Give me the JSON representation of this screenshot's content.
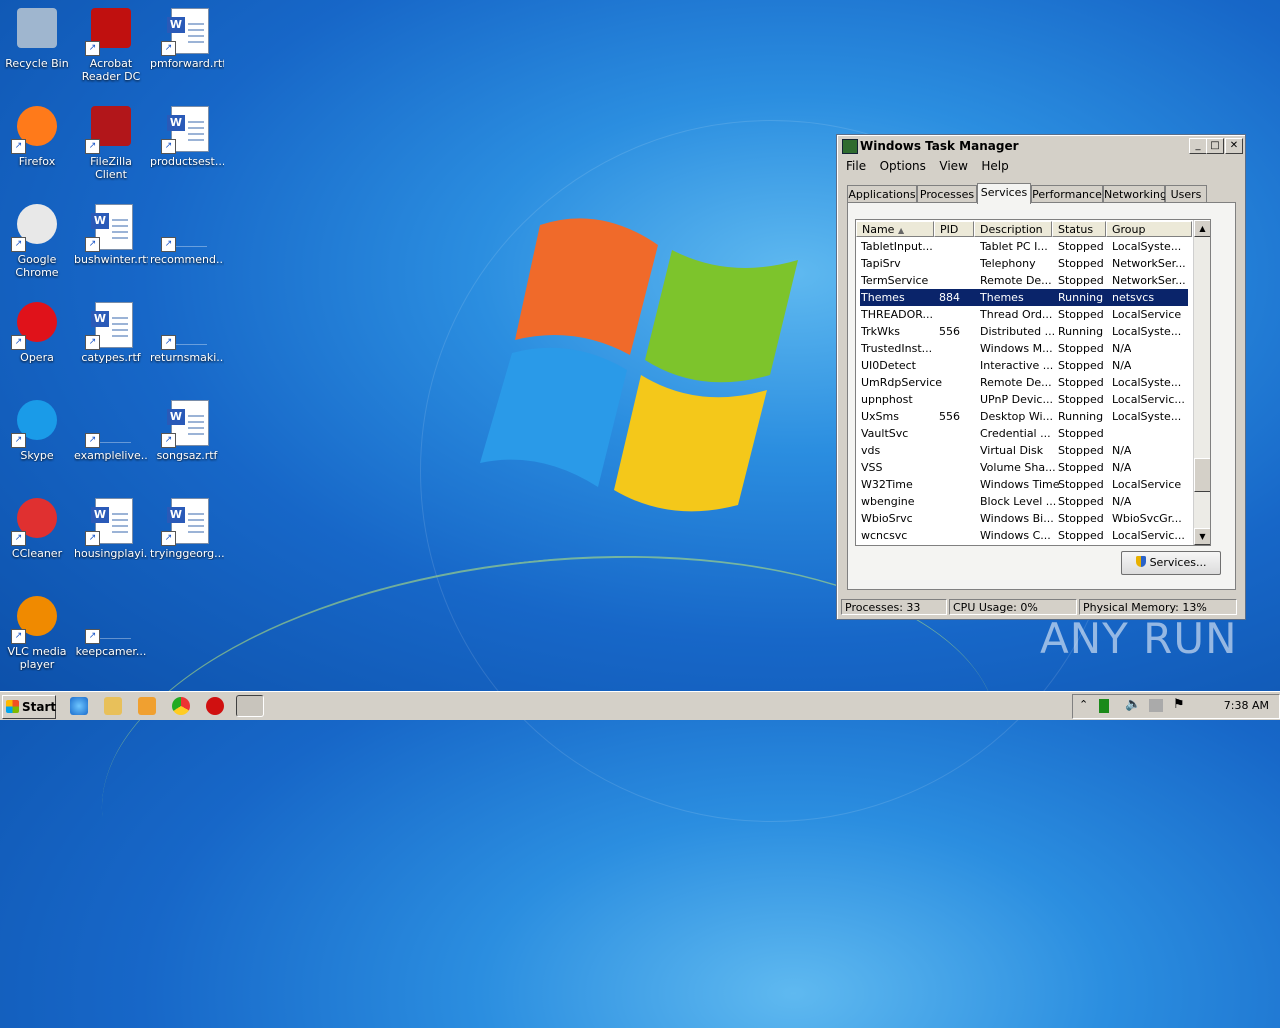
{
  "desktop": {
    "icons": [
      {
        "label": "Recycle Bin",
        "icon": "recycle-bin-icon"
      },
      {
        "label": "Acrobat Reader DC",
        "icon": "acrobat-icon"
      },
      {
        "label": "pmforward.rtf",
        "icon": "word-document-icon"
      },
      {
        "label": "Firefox",
        "icon": "firefox-icon"
      },
      {
        "label": "FileZilla Client",
        "icon": "filezilla-icon"
      },
      {
        "label": "productsest...",
        "icon": "word-document-icon"
      },
      {
        "label": "Google Chrome",
        "icon": "chrome-icon"
      },
      {
        "label": "bushwinter.rtf",
        "icon": "word-document-icon"
      },
      {
        "label": "recommend...",
        "icon": "blank-file-icon"
      },
      {
        "label": "Opera",
        "icon": "opera-icon"
      },
      {
        "label": "catypes.rtf",
        "icon": "word-document-icon"
      },
      {
        "label": "returnsmaki...",
        "icon": "blank-file-icon"
      },
      {
        "label": "Skype",
        "icon": "skype-icon"
      },
      {
        "label": "examplelive...",
        "icon": "blank-file-icon"
      },
      {
        "label": "songsaz.rtf",
        "icon": "word-document-icon"
      },
      {
        "label": "CCleaner",
        "icon": "ccleaner-icon"
      },
      {
        "label": "housingplayi...",
        "icon": "word-document-icon"
      },
      {
        "label": "tryinggeorg...",
        "icon": "word-document-icon"
      },
      {
        "label": "VLC media player",
        "icon": "vlc-icon"
      },
      {
        "label": "keepcamer...",
        "icon": "blank-file-icon"
      }
    ]
  },
  "taskmgr": {
    "title": "Windows Task Manager",
    "menu": [
      "File",
      "Options",
      "View",
      "Help"
    ],
    "tabs": [
      "Applications",
      "Processes",
      "Services",
      "Performance",
      "Networking",
      "Users"
    ],
    "active_tab": "Services",
    "columns": [
      "Name",
      "PID",
      "Description",
      "Status",
      "Group"
    ],
    "rows": [
      {
        "name": "TabletInput...",
        "pid": "",
        "desc": "Tablet PC I...",
        "status": "Stopped",
        "group": "LocalSyste..."
      },
      {
        "name": "TapiSrv",
        "pid": "",
        "desc": "Telephony",
        "status": "Stopped",
        "group": "NetworkSer..."
      },
      {
        "name": "TermService",
        "pid": "",
        "desc": "Remote De...",
        "status": "Stopped",
        "group": "NetworkSer..."
      },
      {
        "name": "Themes",
        "pid": "884",
        "desc": "Themes",
        "status": "Running",
        "group": "netsvcs"
      },
      {
        "name": "THREADOR...",
        "pid": "",
        "desc": "Thread Ord...",
        "status": "Stopped",
        "group": "LocalService"
      },
      {
        "name": "TrkWks",
        "pid": "556",
        "desc": "Distributed ...",
        "status": "Running",
        "group": "LocalSyste..."
      },
      {
        "name": "TrustedInst...",
        "pid": "",
        "desc": "Windows M...",
        "status": "Stopped",
        "group": "N/A"
      },
      {
        "name": "UI0Detect",
        "pid": "",
        "desc": "Interactive ...",
        "status": "Stopped",
        "group": "N/A"
      },
      {
        "name": "UmRdpService",
        "pid": "",
        "desc": "Remote De...",
        "status": "Stopped",
        "group": "LocalSyste..."
      },
      {
        "name": "upnphost",
        "pid": "",
        "desc": "UPnP Devic...",
        "status": "Stopped",
        "group": "LocalServic..."
      },
      {
        "name": "UxSms",
        "pid": "556",
        "desc": "Desktop Wi...",
        "status": "Running",
        "group": "LocalSyste..."
      },
      {
        "name": "VaultSvc",
        "pid": "",
        "desc": "Credential ...",
        "status": "Stopped",
        "group": ""
      },
      {
        "name": "vds",
        "pid": "",
        "desc": "Virtual Disk",
        "status": "Stopped",
        "group": "N/A"
      },
      {
        "name": "VSS",
        "pid": "",
        "desc": "Volume Sha...",
        "status": "Stopped",
        "group": "N/A"
      },
      {
        "name": "W32Time",
        "pid": "",
        "desc": "Windows Time",
        "status": "Stopped",
        "group": "LocalService"
      },
      {
        "name": "wbengine",
        "pid": "",
        "desc": "Block Level ...",
        "status": "Stopped",
        "group": "N/A"
      },
      {
        "name": "WbioSrvc",
        "pid": "",
        "desc": "Windows Bi...",
        "status": "Stopped",
        "group": "WbioSvcGr..."
      },
      {
        "name": "wcncsvc",
        "pid": "",
        "desc": "Windows C...",
        "status": "Stopped",
        "group": "LocalServic..."
      }
    ],
    "selected_row": "Themes",
    "services_button": "Services...",
    "status": {
      "processes": "Processes: 33",
      "cpu": "CPU Usage: 0%",
      "memory": "Physical Memory: 13%"
    }
  },
  "taskbar": {
    "start_label": "Start",
    "clock": "7:38 AM"
  },
  "watermark": "ANY RUN"
}
